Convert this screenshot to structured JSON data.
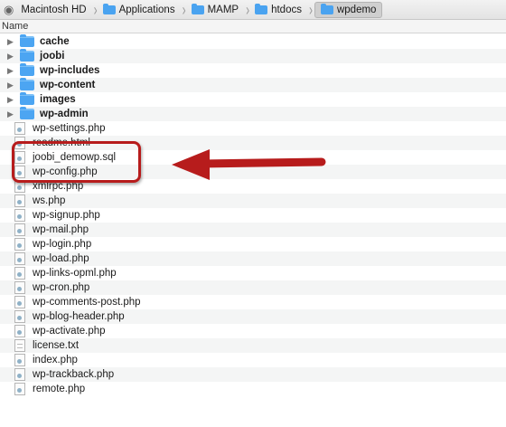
{
  "breadcrumb": [
    {
      "label": "Macintosh HD",
      "icon": "disk-icon"
    },
    {
      "label": "Applications",
      "icon": "folder-icon"
    },
    {
      "label": "MAMP",
      "icon": "folder-icon"
    },
    {
      "label": "htdocs",
      "icon": "folder-icon"
    },
    {
      "label": "wpdemo",
      "icon": "folder-icon"
    }
  ],
  "column_header": "Name",
  "rows": [
    {
      "name": "cache",
      "kind": "folder"
    },
    {
      "name": "joobi",
      "kind": "folder"
    },
    {
      "name": "wp-includes",
      "kind": "folder"
    },
    {
      "name": "wp-content",
      "kind": "folder"
    },
    {
      "name": "images",
      "kind": "folder"
    },
    {
      "name": "wp-admin",
      "kind": "folder"
    },
    {
      "name": "wp-settings.php",
      "kind": "file"
    },
    {
      "name": "readme.html",
      "kind": "file"
    },
    {
      "name": "joobi_demowp.sql",
      "kind": "file"
    },
    {
      "name": "wp-config.php",
      "kind": "file"
    },
    {
      "name": "xmlrpc.php",
      "kind": "file"
    },
    {
      "name": "ws.php",
      "kind": "file"
    },
    {
      "name": "wp-signup.php",
      "kind": "file"
    },
    {
      "name": "wp-mail.php",
      "kind": "file"
    },
    {
      "name": "wp-login.php",
      "kind": "file"
    },
    {
      "name": "wp-load.php",
      "kind": "file"
    },
    {
      "name": "wp-links-opml.php",
      "kind": "file"
    },
    {
      "name": "wp-cron.php",
      "kind": "file"
    },
    {
      "name": "wp-comments-post.php",
      "kind": "file"
    },
    {
      "name": "wp-blog-header.php",
      "kind": "file"
    },
    {
      "name": "wp-activate.php",
      "kind": "file"
    },
    {
      "name": "license.txt",
      "kind": "text"
    },
    {
      "name": "index.php",
      "kind": "file"
    },
    {
      "name": "wp-trackback.php",
      "kind": "file"
    },
    {
      "name": "remote.php",
      "kind": "file"
    }
  ],
  "colors": {
    "annotation": "#b71c1c",
    "folder": "#4ca5f2"
  }
}
